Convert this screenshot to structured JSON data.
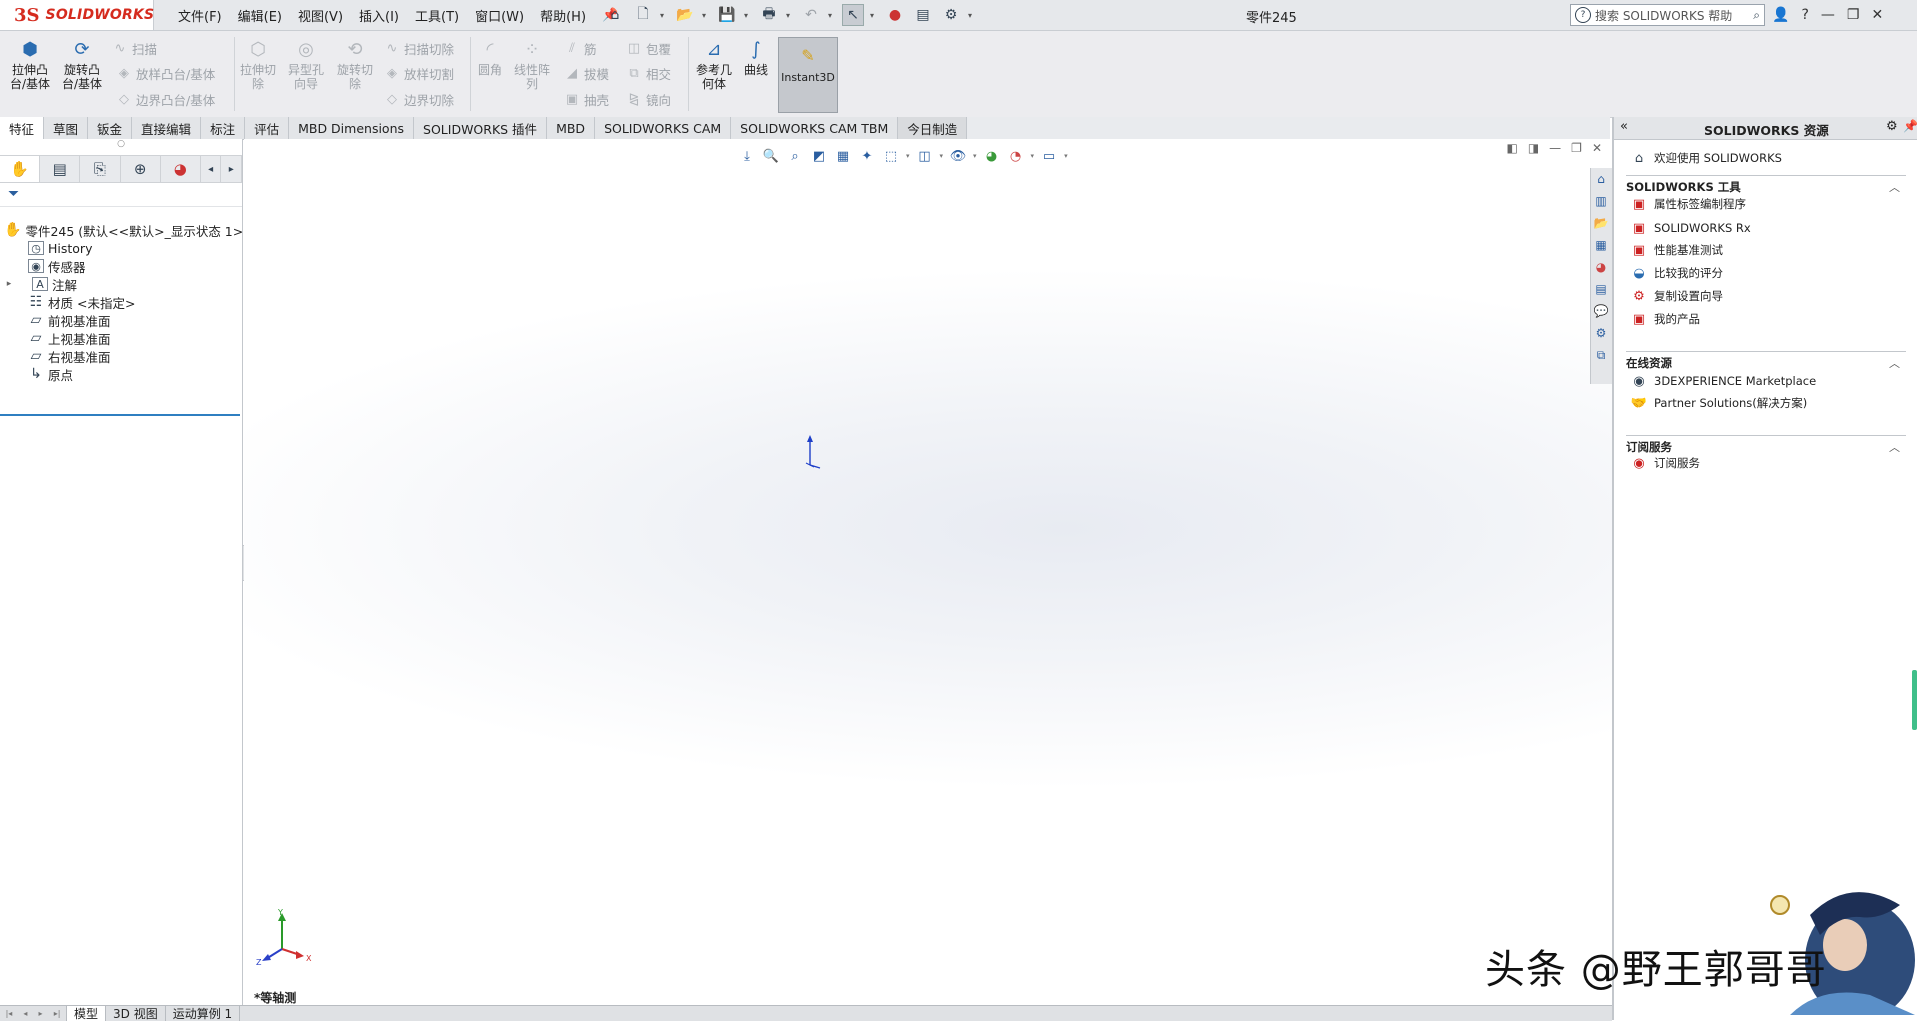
{
  "app": {
    "logo_ds": "3S",
    "logo_text": "SOLIDWORKS",
    "doc_title": "零件245"
  },
  "menu": [
    "文件(F)",
    "编辑(E)",
    "视图(V)",
    "插入(I)",
    "工具(T)",
    "窗口(W)",
    "帮助(H)"
  ],
  "search": {
    "placeholder": "搜索 SOLIDWORKS 帮助"
  },
  "ribbon": {
    "extrude": "拉伸凸\n台/基体",
    "revolve": "旋转凸\n台/基体",
    "sweep": "扫描",
    "loft": "放样凸台/基体",
    "boundary": "边界凸台/基体",
    "extrude_cut": "拉伸切\n除",
    "hole_wizard": "异型孔\n向导",
    "revolve_cut": "旋转切\n除",
    "swept_cut": "扫描切除",
    "lofted_cut": "放样切割",
    "boundary_cut": "边界切除",
    "fillet": "圆角",
    "linear_pattern": "线性阵\n列",
    "rib": "筋",
    "draft": "拔模",
    "shell": "抽壳",
    "wrap": "包覆",
    "intersect": "相交",
    "mirror": "镜向",
    "ref_geometry": "参考几\n何体",
    "curves": "曲线",
    "instant3d": "Instant3D"
  },
  "tabs": [
    "特征",
    "草图",
    "钣金",
    "直接编辑",
    "标注",
    "评估",
    "MBD Dimensions",
    "SOLIDWORKS 插件",
    "MBD",
    "SOLIDWORKS CAM",
    "SOLIDWORKS CAM TBM",
    "今日制造"
  ],
  "tree": {
    "root": "零件245  (默认<<默认>_显示状态 1>)",
    "items": [
      "History",
      "传感器",
      "注解",
      "材质 <未指定>",
      "前视基准面",
      "上视基准面",
      "右视基准面",
      "原点"
    ]
  },
  "viewport": {
    "view_name": "*等轴测",
    "triad_x": "X",
    "triad_y": "Y",
    "triad_z": "Z"
  },
  "bottom_tabs": [
    "模型",
    "3D 视图",
    "运动算例 1"
  ],
  "task_pane": {
    "title": "SOLIDWORKS 资源",
    "welcome": "欢迎使用  SOLIDWORKS",
    "sec_tools": "SOLIDWORKS 工具",
    "tools": [
      "属性标签编制程序",
      "SOLIDWORKS Rx",
      "性能基准测试",
      "比较我的评分",
      "复制设置向导",
      "我的产品"
    ],
    "sec_online": "在线资源",
    "online": [
      "3DEXPERIENCE Marketplace",
      "Partner Solutions(解决方案)"
    ],
    "sec_sub": "订阅服务",
    "sub": [
      "订阅服务"
    ]
  },
  "watermark": "头条 @野王郭哥哥",
  "colors": {
    "brand": "#d52b1e",
    "accent": "#2f7fc1"
  }
}
